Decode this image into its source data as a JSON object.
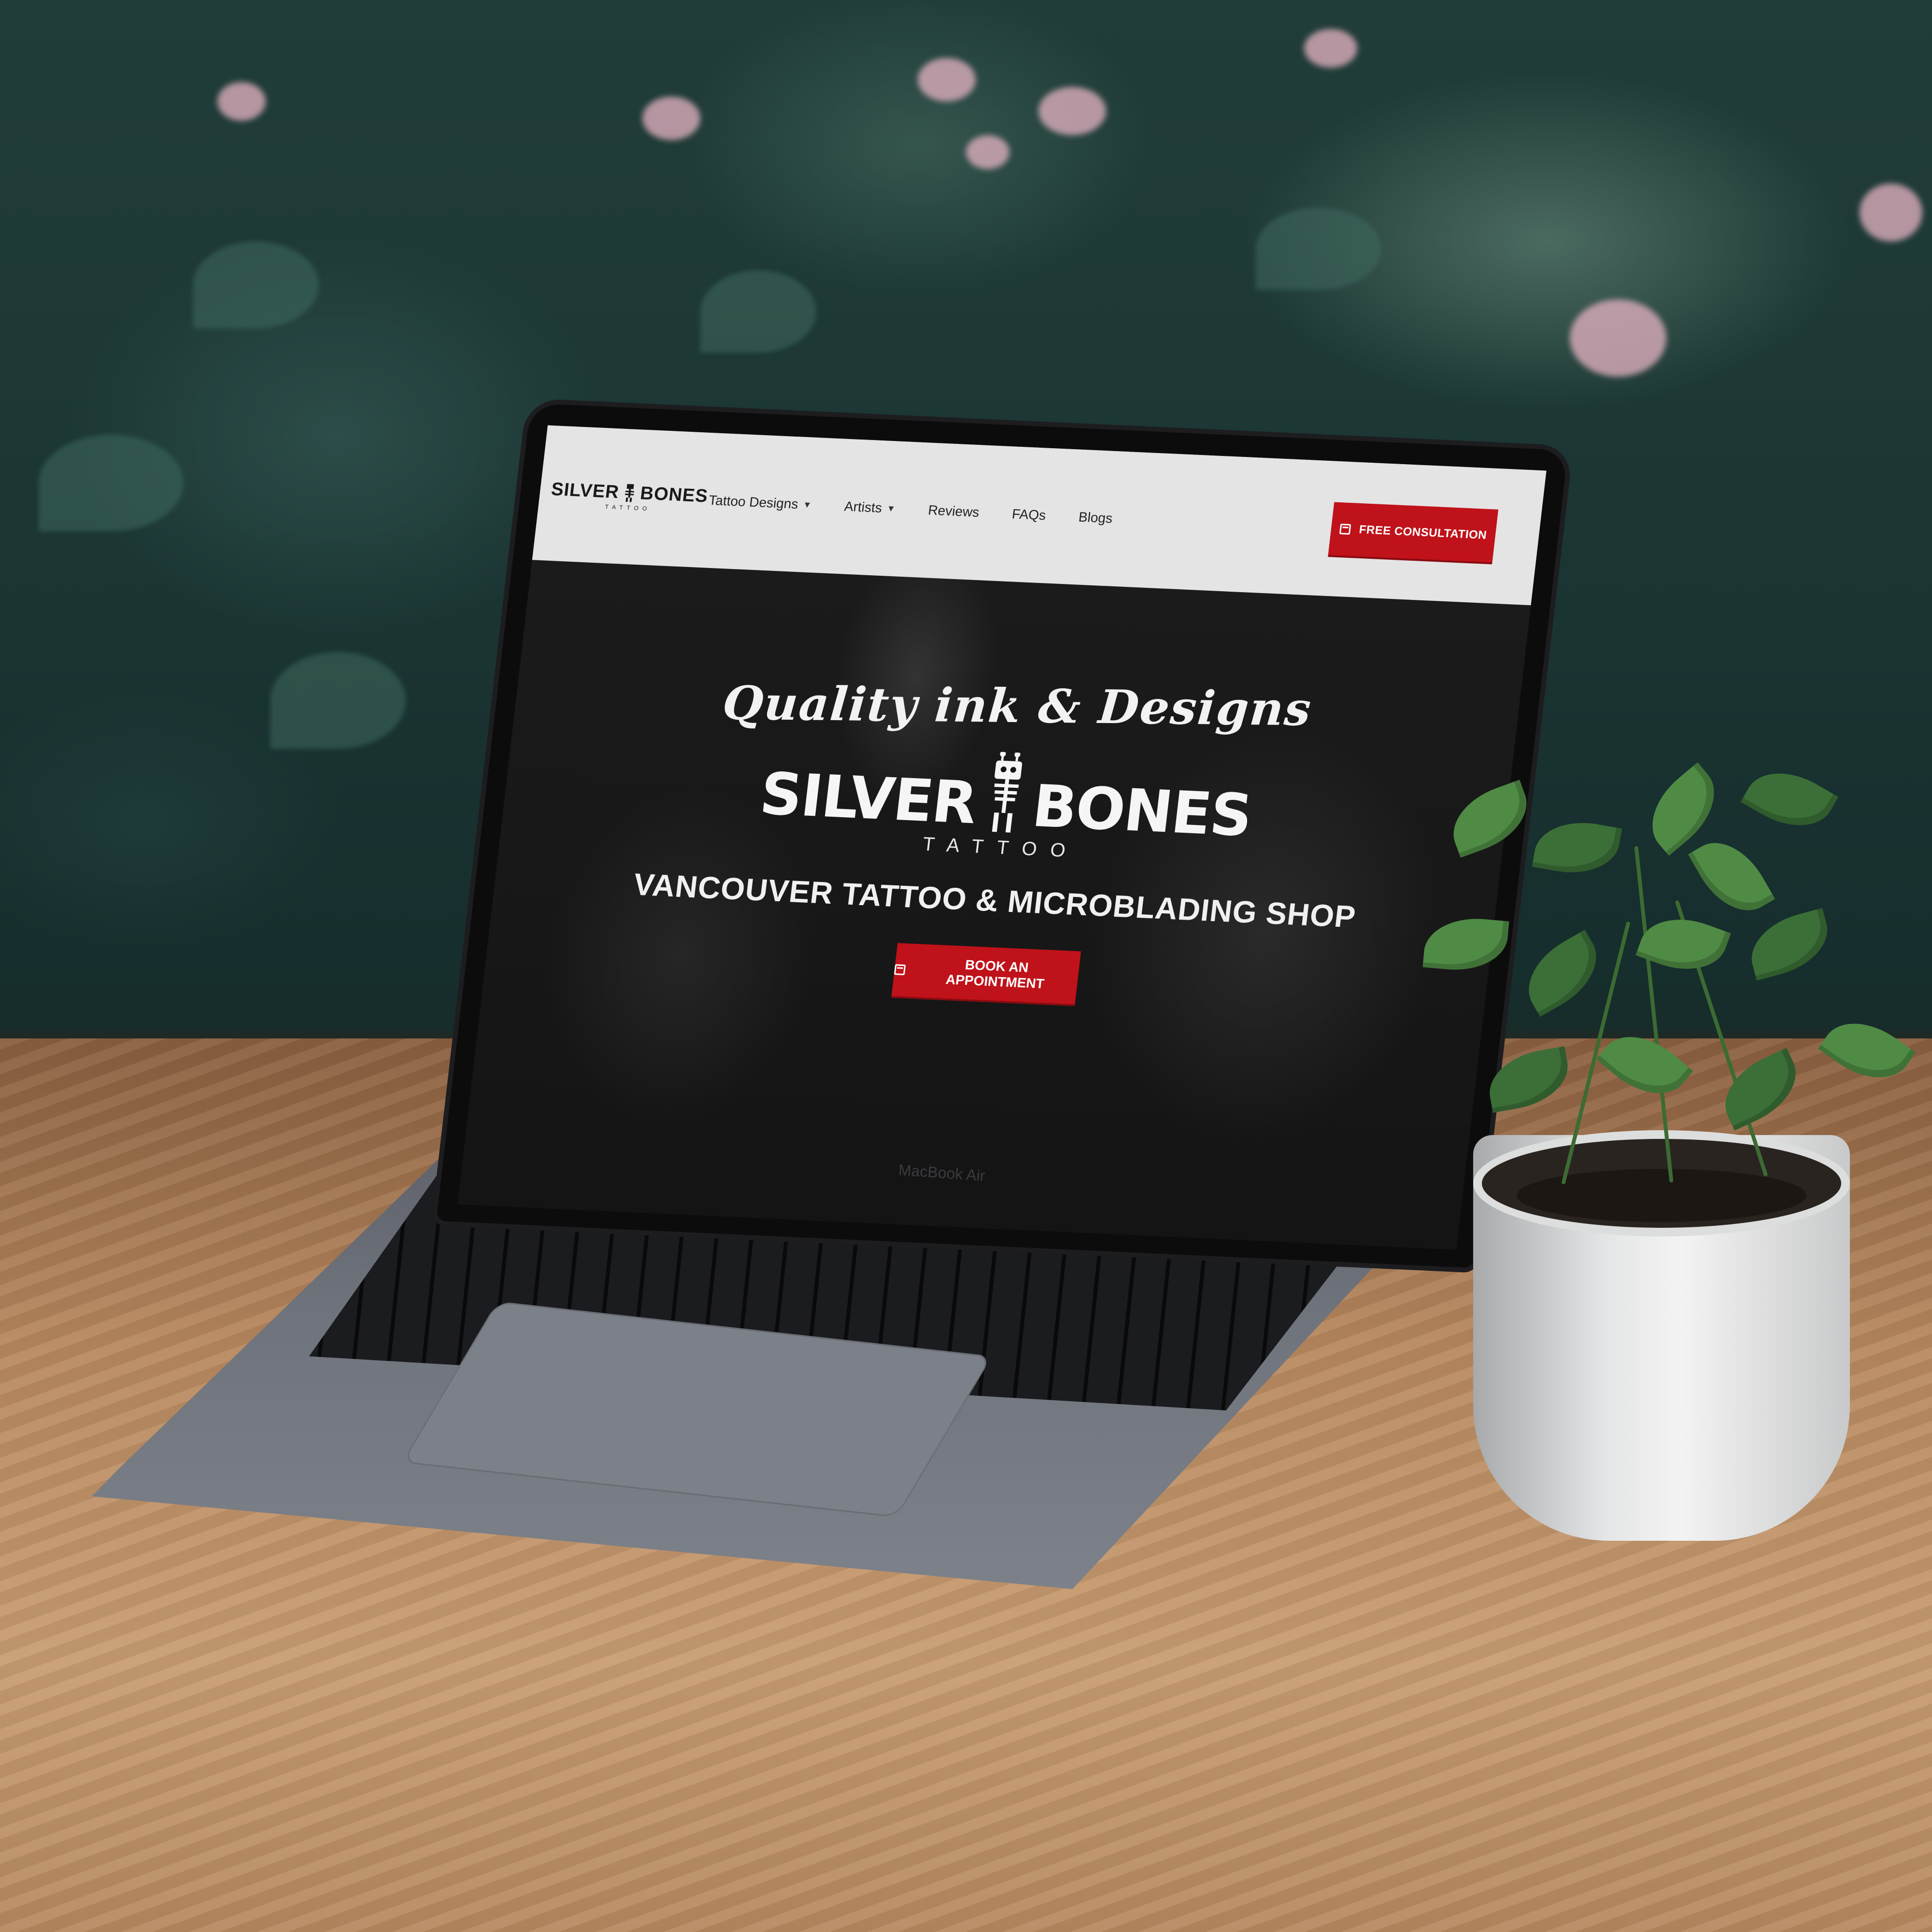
{
  "nav": {
    "logo": {
      "brand": "SILVER BONES",
      "sub": "TATTOO",
      "icon": "robot-skeleton-icon"
    },
    "menu": [
      {
        "label": "Tattoo Designs",
        "dropdown": true
      },
      {
        "label": "Artists",
        "dropdown": true
      },
      {
        "label": "Reviews",
        "dropdown": false
      },
      {
        "label": "FAQs",
        "dropdown": false
      },
      {
        "label": "Blogs",
        "dropdown": false
      }
    ],
    "cta_label": "FREE CONSULTATION",
    "cta_icon": "calendar-icon"
  },
  "hero": {
    "tagline": "Quality ink & Designs",
    "logo_left": "SILVER",
    "logo_right": "BONES",
    "logo_sub": "TATTOO",
    "subtitle": "VANCOUVER TATTOO & MICROBLADING SHOP",
    "book_label": "BOOK AN APPOINTMENT",
    "book_icon": "calendar-icon"
  },
  "device": {
    "label": "MacBook Air"
  },
  "colors": {
    "accent": "#c0121a",
    "nav_bg": "#e4e4e4",
    "hero_bg": "#141414"
  }
}
